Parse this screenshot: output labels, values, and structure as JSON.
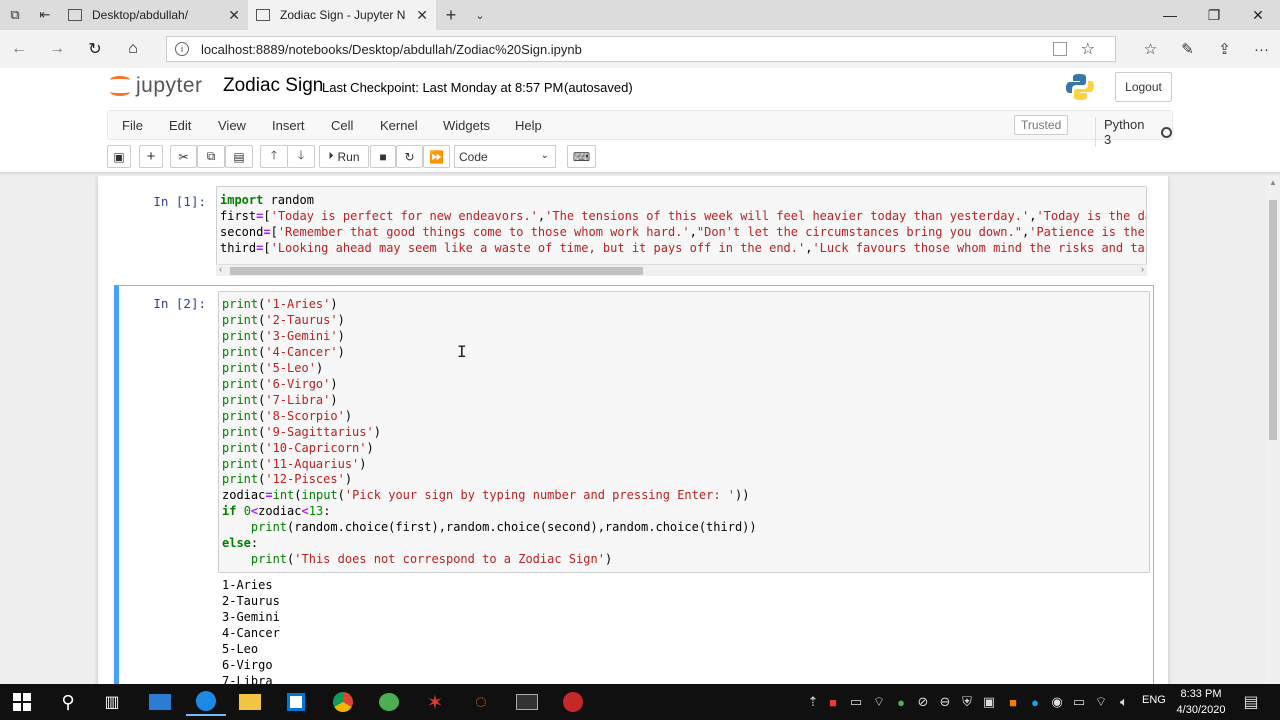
{
  "browser": {
    "tabs": [
      {
        "title": "Desktop/abdullah/",
        "active": false
      },
      {
        "title": "Zodiac Sign - Jupyter N",
        "active": true
      }
    ],
    "url": "localhost:8889/notebooks/Desktop/abdullah/Zodiac%20Sign.ipynb"
  },
  "jupyter": {
    "logo_text": "jupyter",
    "notebook_name": "Zodiac Sign",
    "checkpoint": "Last Checkpoint: Last Monday at 8:57 PM",
    "autosave": "(autosaved)",
    "logout_label": "Logout",
    "menu": [
      "File",
      "Edit",
      "View",
      "Insert",
      "Cell",
      "Kernel",
      "Widgets",
      "Help"
    ],
    "trusted_label": "Trusted",
    "kernel_name": "Python 3",
    "toolbar": {
      "run_label": "Run",
      "cell_type": "Code"
    }
  },
  "cells": {
    "cell1_prompt": "In [1]:",
    "cell2_prompt": "In [2]:"
  },
  "output_lines": [
    "1-Aries",
    "2-Taurus",
    "3-Gemini",
    "4-Cancer",
    "5-Leo",
    "6-Virgo",
    "7-Libra"
  ],
  "taskbar": {
    "lang": "ENG",
    "time": "8:33 PM",
    "date": "4/30/2020"
  },
  "colors": {
    "accent_blue": "#42a5f5",
    "prompt_blue": "#303f9f",
    "jupyter_orange": "#f37726",
    "string_red": "#ba2121",
    "keyword_green": "#008000"
  }
}
